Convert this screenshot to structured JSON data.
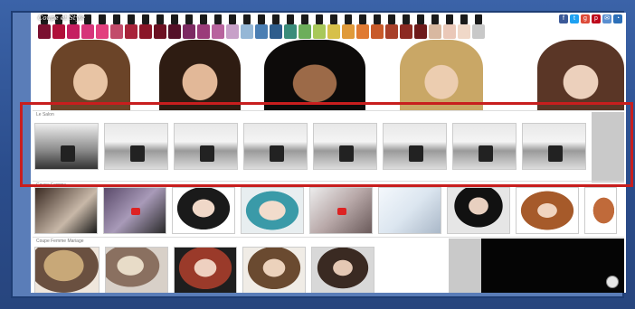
{
  "header": {
    "logo_text": "Coupe et Style",
    "polish_colors": [
      "#7a1030",
      "#b0103a",
      "#c51e60",
      "#d6357a",
      "#e2407e",
      "#c24b6a",
      "#a8233a",
      "#8a1628",
      "#6c1022",
      "#541028",
      "#7c2a62",
      "#9a3c7a",
      "#b8649e",
      "#c7a0c8",
      "#95b7d6",
      "#4a7eb3",
      "#2e5d8c",
      "#3a8c7a",
      "#6cae5a",
      "#a8c85a",
      "#d7c04a",
      "#e09a3a",
      "#e07a32",
      "#c85a2a",
      "#a8402a",
      "#8c2a22",
      "#6e1a1a",
      "#d8b8a0",
      "#eac8b8",
      "#f0d8c8",
      "#c8c8c8"
    ],
    "social_icons": [
      "facebook-icon",
      "twitter-icon",
      "google-plus-icon",
      "pinterest-icon",
      "mail-icon",
      "rss-icon"
    ]
  },
  "sections": {
    "salon": {
      "title": "Le Salon"
    },
    "coupe_femme": {
      "title": "Coupe Femme"
    },
    "coupe_mariage": {
      "title": "Coupe Femme Mariage"
    }
  },
  "colors": {
    "highlight_border": "#c81e1e",
    "background": "#2d4f8a"
  }
}
